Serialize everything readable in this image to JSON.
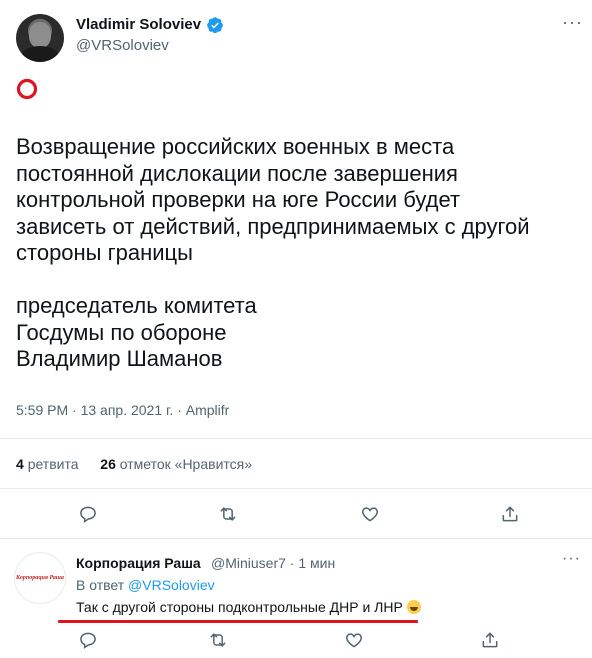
{
  "tweet": {
    "author_name": "Vladimir Soloviev",
    "author_handle": "@VRSoloviev",
    "more_label": "···",
    "paragraph1_lines": [
      "Возвращение российских военных в места",
      "постоянной дислокации после завершения",
      "контрольной проверки на юге России будет",
      "зависеть от действий, предпринимаемых с другой",
      "стороны границы"
    ],
    "paragraph2_lines": [
      "председатель комитета",
      "Госдумы по обороне",
      "Владимир Шаманов"
    ],
    "time": "5:59 PM",
    "date": "13 апр. 2021 г.",
    "source": "Amplifr",
    "separator": "·",
    "retweets_count": "4",
    "retweets_label": "ретвита",
    "likes_count": "26",
    "likes_label": "отметок «Нравится»",
    "accent_color": "#1d9bf0",
    "ring_color": "#e0141e",
    "actions": [
      "reply-icon",
      "retweet-icon",
      "like-icon",
      "share-icon"
    ]
  },
  "reply": {
    "author_name": "Корпорация Раша",
    "author_handle_time": "@Miniuser7 · 1 мин",
    "replying_prefix": "В ответ",
    "replying_to": "@VRSoloviev",
    "text": "Так с другой стороны подконтрольные ДНР и ЛНР",
    "emoji": "grinning-face-emoji",
    "avatar_logo": "Корпорация Раша",
    "underline_color": "#e0141e",
    "more_label": "···"
  }
}
